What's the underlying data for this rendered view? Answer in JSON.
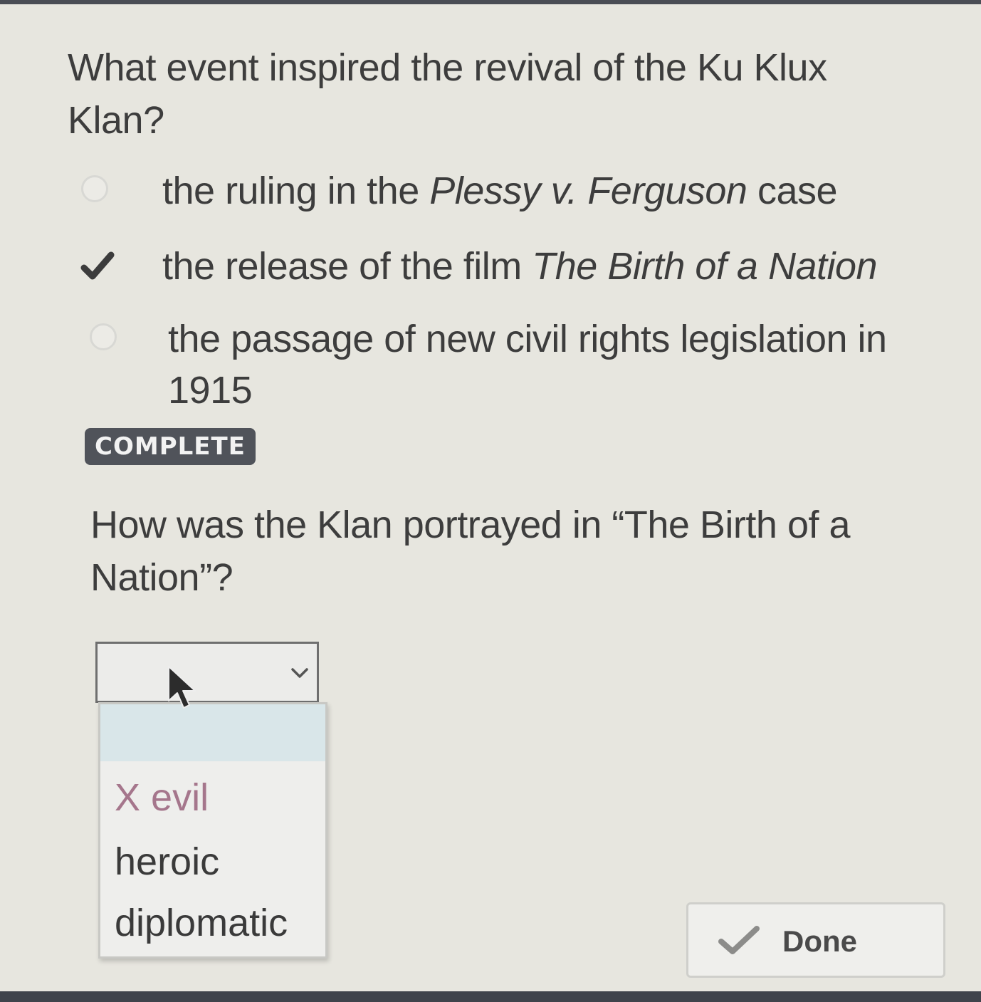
{
  "question_1": {
    "prompt": "What event inspired the revival of the Ku Klux Klan?",
    "options": [
      {
        "text_before": "the ruling in the ",
        "text_italic": "Plessy v. Ferguson",
        "text_after": " case",
        "selected": false
      },
      {
        "text_before": "the release of the film ",
        "text_italic": "The Birth of a Nation",
        "text_after": "",
        "selected": true
      },
      {
        "text_before": "the passage of new civil rights legislation in 1915",
        "text_italic": "",
        "text_after": "",
        "selected": false
      }
    ],
    "status_badge": "COMPLETE"
  },
  "question_2": {
    "prompt": "How was the Klan portrayed in “The Birth of a Nation”?",
    "dropdown": {
      "selected_value": "",
      "options": [
        {
          "mark": "X",
          "label": "evil",
          "marked_incorrect": true
        },
        {
          "label": "heroic"
        },
        {
          "label": "diplomatic"
        }
      ]
    }
  },
  "done_button": {
    "label": "Done"
  },
  "colors": {
    "background": "#e7e6df",
    "badge": "#50535a",
    "incorrect": "#a5768c",
    "highlight_option": "#d9e6e9",
    "check": "#3c3c3c"
  },
  "icons": [
    "radio-icon",
    "checkmark-icon",
    "chevron-down-icon",
    "mouse-cursor-icon",
    "done-check-icon"
  ]
}
